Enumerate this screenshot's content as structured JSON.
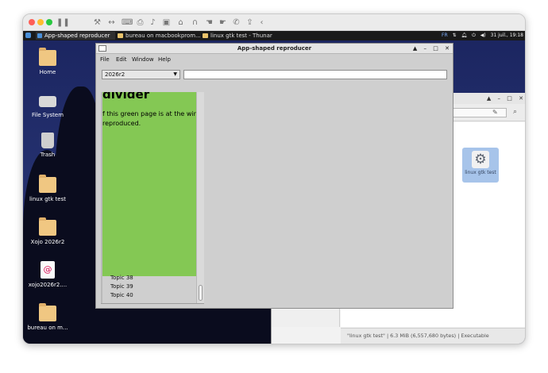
{
  "mac_toolbar": {
    "icons": [
      "pause-icon",
      "wrench-icon",
      "resize-icon",
      "keyboard-icon",
      "printer-icon",
      "volume-icon",
      "camera-icon",
      "usb-icon",
      "share-icon",
      "back-icon"
    ]
  },
  "panel": {
    "tasks": [
      {
        "label": "App-shaped reproducer",
        "active": true
      },
      {
        "label": "bureau on macbookprom...",
        "active": false
      },
      {
        "label": "linux gtk test - Thunar",
        "active": false
      }
    ],
    "lang": "FR",
    "datetime": "31 juil., 19:18"
  },
  "desktop_icons": [
    {
      "label": "Home"
    },
    {
      "label": "File System"
    },
    {
      "label": "Trash"
    },
    {
      "label": "linux gtk test"
    },
    {
      "label": "Xojo 2026r2"
    },
    {
      "label": "xojo2026r2...."
    },
    {
      "label": "bureau on m..."
    }
  ],
  "app": {
    "title": "App-shaped reproducer",
    "window_controls": [
      "▲",
      "–",
      "□",
      "✕"
    ],
    "menu": [
      "File",
      "Edit",
      "Window",
      "Help"
    ],
    "select_value": "2026r2",
    "input_value": "",
    "green_heading": "divider",
    "green_text_line1": "f this green page is at the window",
    "green_text_line2": "reproduced.",
    "list_items": [
      "Topic 38",
      "Topic 39",
      "Topic 40"
    ],
    "colors": {
      "green_panel": "#84c854",
      "window_bg": "#cfcfcf"
    }
  },
  "thunar": {
    "window_controls": [
      "▲",
      "–",
      "□",
      "✕"
    ],
    "file_label": "linux gtk test",
    "status": "\"linux gtk test\"  |  6.3 MiB (6,557,680 bytes)  |  Executable"
  }
}
